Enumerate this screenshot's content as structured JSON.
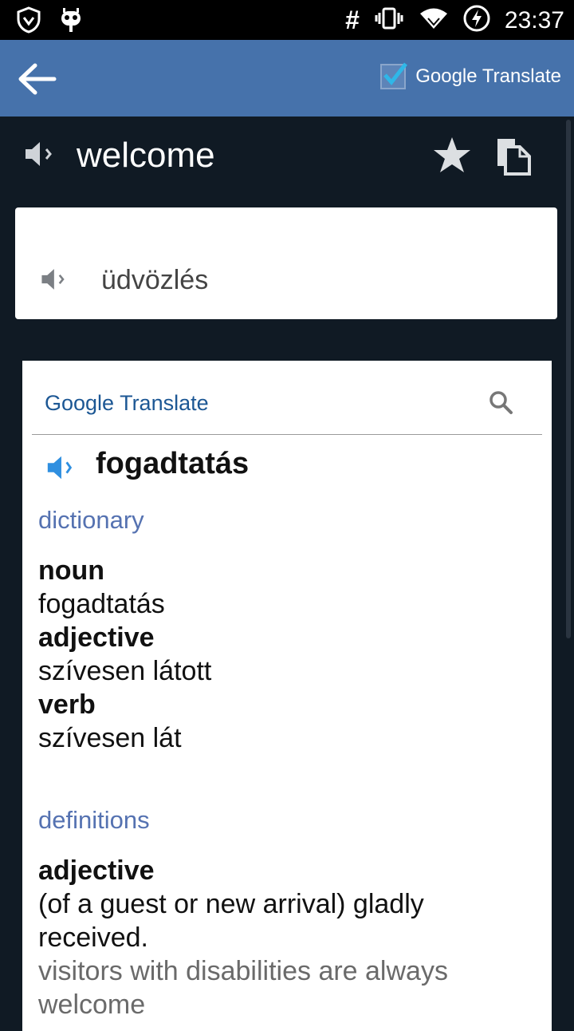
{
  "status": {
    "time": "23:37"
  },
  "appbar": {
    "toggle_label": "Google Translate"
  },
  "entry": {
    "word": "welcome"
  },
  "translation": {
    "text": "üdvözlés"
  },
  "google": {
    "header": "Google Translate",
    "main_translation": "fogadtatás",
    "dictionary": {
      "title": "dictionary",
      "items": [
        {
          "pos": "noun",
          "value": "fogadtatás"
        },
        {
          "pos": "adjective",
          "value": "szívesen látott"
        },
        {
          "pos": "verb",
          "value": "szívesen lát"
        }
      ]
    },
    "definitions": {
      "title": "definitions",
      "pos": "adjective",
      "definition": "(of a guest or new arrival) gladly received.",
      "example": "visitors with disabilities are always welcome"
    }
  },
  "colors": {
    "appbar": "#4672ab",
    "background": "#101a24",
    "link": "#1c5794",
    "section": "#5572b1"
  }
}
